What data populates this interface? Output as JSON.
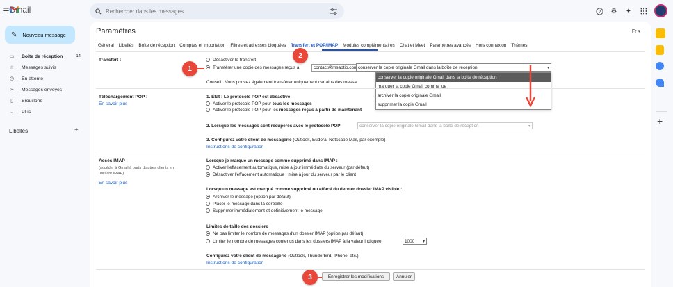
{
  "app": {
    "name": "Gmail"
  },
  "search": {
    "placeholder": "Rechercher dans les messages"
  },
  "sidebar": {
    "compose": "Nouveau message",
    "items": [
      {
        "label": "Boîte de réception",
        "count": "14",
        "icon": "inbox-icon"
      },
      {
        "label": "Messages suivis",
        "icon": "star-icon"
      },
      {
        "label": "En attente",
        "icon": "clock-icon"
      },
      {
        "label": "Messages envoyés",
        "icon": "send-icon"
      },
      {
        "label": "Brouillons",
        "icon": "draft-icon"
      },
      {
        "label": "Plus",
        "icon": "chevron-down-icon"
      }
    ],
    "labels_title": "Libellés"
  },
  "settings": {
    "title": "Paramètres",
    "lang": "Fr ▾",
    "tabs": [
      "Général",
      "Libellés",
      "Boîte de réception",
      "Comptes et importation",
      "Filtres et adresses bloquées",
      "Transfert et POP/IMAP",
      "Modules complémentaires",
      "Chat et Meet",
      "Paramètres avancés",
      "Hors connexion",
      "Thèmes"
    ],
    "active_tab": "Transfert et POP/IMAP",
    "forward": {
      "label": "Transfert :",
      "disable": "Désactiver le transfert",
      "enable": "Transférer une copie des messages reçus à",
      "email": "contact@msaptio.com",
      "and": "et",
      "select_value": "conserver la copie originale Gmail dans la boîte de réception",
      "options": [
        "conserver la copie originale Gmail dans la boîte de réception",
        "marquer la copie Gmail comme lue",
        "archiver la copie originale Gmail",
        "supprimer la copie Gmail"
      ],
      "tip": "Conseil : Vous pouvez également transférer uniquement certains des messa"
    },
    "pop": {
      "label": "Téléchargement POP :",
      "learn": "En savoir plus",
      "status": "1. État : Le protocole POP est désactivé",
      "opt1_a": "Activer le protocole POP pour ",
      "opt1_b": "tous les messages",
      "opt2_a": "Activer le protocole POP pour les ",
      "opt2_b": "messages reçus à partir de maintenant",
      "q2": "2. Lorsque les messages sont récupérés avec le protocole POP",
      "q2_select": "conserver la copie originale Gmail dans la boîte de réception",
      "q3_a": "3. Configurez votre client de messagerie",
      "q3_b": " (Outlook, Eudora, Netscape Mail, par exemple)",
      "instructions": "Instructions de configuration"
    },
    "imap": {
      "label": "Accès IMAP :",
      "sub": "(accéder à Gmail à partir d'autres clients en utilisant IMAP)",
      "learn": "En savoir plus",
      "h1": "Lorsque je marque un message comme supprimé dans IMAP :",
      "h1_o1": "Activer l'effacement automatique, mise à jour immédiate du serveur (par défaut)",
      "h1_o2": "Désactiver l'effacement automatique : mise à jour du serveur par le client",
      "h2": "Lorsqu'un message est marqué comme supprimé ou effacé du dernier dossier IMAP visible :",
      "h2_o1": "Archiver le message (option par défaut)",
      "h2_o2": "Placer le message dans la corbeille",
      "h2_o3": "Supprimer immédiatement et définitivement le message",
      "h3": "Limites de taille des dossiers",
      "h3_o1": "Ne pas limiter le nombre de messages d'un dossier IMAP (option par défaut)",
      "h3_o2": "Limiter le nombre de messages contenus dans les dossiers IMAP à la valeur indiquée",
      "limit": "1000",
      "h4_a": "Configurez votre client de messagerie",
      "h4_b": " (Outlook, Thunderbird, iPhone, etc.)",
      "instructions": "Instructions de configuration"
    },
    "save": "Enregistrer les modifications",
    "cancel": "Annuler"
  },
  "annotations": [
    "1",
    "2",
    "3"
  ],
  "colors": {
    "accent": "#1a55c7",
    "annotation": "#e8473a",
    "compose": "#c2e7ff"
  }
}
